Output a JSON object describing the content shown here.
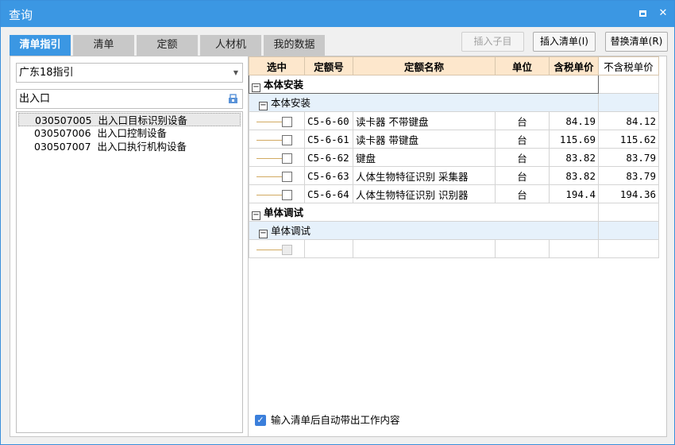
{
  "window": {
    "title": "查询"
  },
  "tabs": [
    {
      "label": "清单指引",
      "active": true
    },
    {
      "label": "清单"
    },
    {
      "label": "定额"
    },
    {
      "label": "人材机"
    },
    {
      "label": "我的数据"
    }
  ],
  "toolbar": {
    "insert_child": "插入子目",
    "insert_bill": "插入清单(I)",
    "replace_bill": "替换清单(R)"
  },
  "left": {
    "guide_select": "广东18指引",
    "search_value": "出入口",
    "items": [
      {
        "code": "030507005",
        "name": "出入口目标识别设备"
      },
      {
        "code": "030507006",
        "name": "出入口控制设备"
      },
      {
        "code": "030507007",
        "name": "出入口执行机构设备"
      }
    ]
  },
  "grid": {
    "headers": [
      "选中",
      "定额号",
      "定额名称",
      "单位",
      "含税单价",
      "不含税单价"
    ],
    "group1": "本体安装",
    "group1_sub": "本体安装",
    "rows": [
      {
        "code": "C5-6-60",
        "name": "读卡器 不带键盘",
        "unit": "台",
        "price_tax": "84.19",
        "price": "84.12"
      },
      {
        "code": "C5-6-61",
        "name": "读卡器 带键盘",
        "unit": "台",
        "price_tax": "115.69",
        "price": "115.62"
      },
      {
        "code": "C5-6-62",
        "name": "键盘",
        "unit": "台",
        "price_tax": "83.82",
        "price": "83.79"
      },
      {
        "code": "C5-6-63",
        "name": "人体生物特征识别 采集器",
        "unit": "台",
        "price_tax": "83.82",
        "price": "83.79"
      },
      {
        "code": "C5-6-64",
        "name": "人体生物特征识别 识别器",
        "unit": "台",
        "price_tax": "194.4",
        "price": "194.36"
      }
    ],
    "group2": "单体调试",
    "group2_sub": "单体调试"
  },
  "footer": {
    "auto_content_label": "输入清单后自动带出工作内容",
    "auto_content_checked": true
  },
  "colors": {
    "accent": "#3b97e3",
    "header_bg": "#fde7cc",
    "subgroup_bg": "#e6f1fb"
  }
}
